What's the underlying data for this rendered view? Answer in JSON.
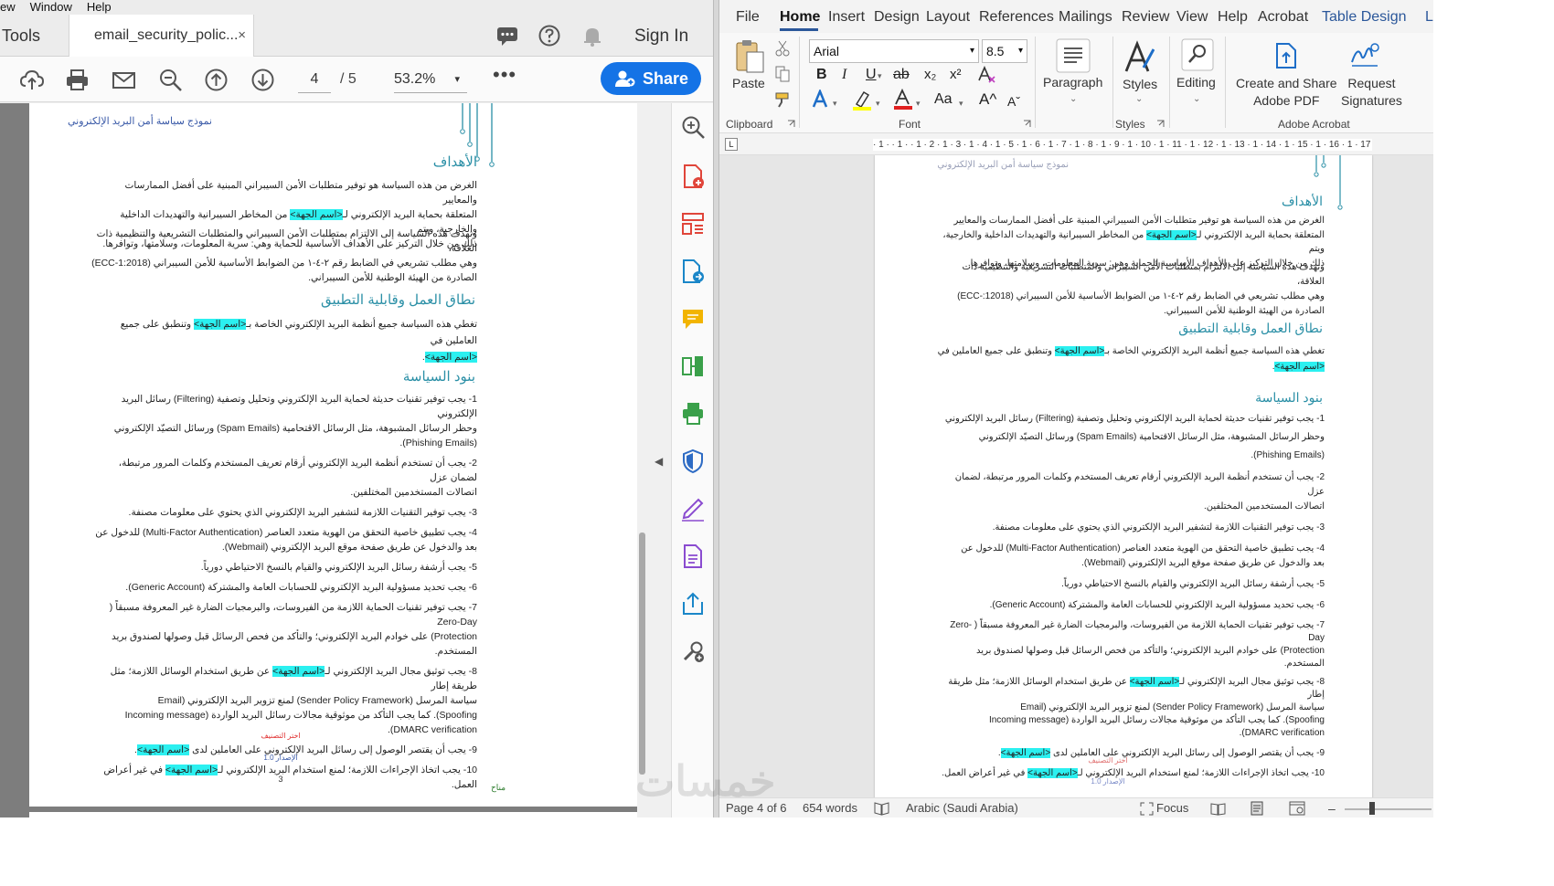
{
  "acrobat": {
    "menu": [
      "ew",
      "Window",
      "Help"
    ],
    "tools_tab": "Tools",
    "doc_tab": "email_security_polic...",
    "doc_tab_close": "×",
    "signin": "Sign In",
    "page_current": "4",
    "page_total": "/ 5",
    "zoom": "53.2%",
    "zoom_caret": "▾",
    "more": "•••",
    "share": "Share",
    "collapse_arrow": "◀",
    "page": {
      "header": "نموذج سياسة أمن البريد الإلكتروني",
      "h_objectives": "الأهداف",
      "p1_a": "الغرض من هذه السياسة هو توفير متطلبات الأمن السيبراني المبنية على أفضل الممارسات والمعايير",
      "p1_b_pre": "المتعلقة بحماية البريد الإلكتروني لـ",
      "p1_b_hl": "<اسم الجهة>",
      "p1_b_post": " من المخاطر السيبرانية والتهديدات الداخلية والخارجية، ويتم",
      "p1_c": "ذلك من خلال التركيز على الأهداف الأساسية للحماية وهي: سرية المعلومات، وسلامتها، وتوافرها.",
      "p2_a": "وتهدف هذه السياسة إلى الالتزام بمتطلبات الأمن السيبراني والمتطلبات التشريعية والتنظيمية ذات العلاقة،",
      "p2_b": "وهي مطلب تشريعي في الضابط رقم ٢-٤-١ من الضوابط الأساسية للأمن السيبراني (ECC-1:2018)",
      "p2_c": "الصادرة من الهيئة الوطنية للأمن السيبراني.",
      "h_scope": "نطاق العمل وقابلية التطبيق",
      "scope_a_pre": "تغطي هذه السياسة جميع أنظمة البريد الإلكتروني الخاصة بـ",
      "scope_a_hl": "<اسم الجهة>",
      "scope_a_post": " وتنطبق على جميع العاملين في",
      "scope_b_hl": "<اسم الجهة>",
      "scope_b_post": ".",
      "h_clauses": "بنود السياسة",
      "c1_a": "1- يجب توفير تقنيات حديثة لحماية البريد الإلكتروني وتحليل وتصفية (Filtering) رسائل البريد الإلكتروني",
      "c1_b": "وحظر الرسائل المشبوهة، مثل الرسائل الاقتحامية (Spam Emails) ورسائل التصيّد الإلكتروني",
      "c1_c": "(Phishing Emails).",
      "c2_a": "2- يجب أن تستخدم أنظمة البريد الإلكتروني أرقام تعريف المستخدم وكلمات المرور مرتبطة، لضمان عزل",
      "c2_b": "اتصالات المستخدمين المختلفين.",
      "c3": "3- يجب توفير التقنيات اللازمة لتشفير البريد الإلكتروني الذي يحتوي على معلومات مصنفة.",
      "c4_a": "4- يجب تطبيق خاصية التحقق من الهوية متعدد العناصر (Multi-Factor Authentication) للدخول عن",
      "c4_b": "بعد والدخول عن طريق صفحة موقع البريد الإلكتروني (Webmail).",
      "c5": "5- يجب أرشفة رسائل البريد الإلكتروني والقيام بالنسخ الاحتياطي دورياً.",
      "c6": "6- يجب تحديد مسؤولية البريد الإلكتروني للحسابات العامة والمشتركة (Generic Account).",
      "c7_a": "7- يجب توفير تقنيات الحماية اللازمة من الفيروسات، والبرمجيات الضارة غير المعروفة مسبقاً ( Zero-Day",
      "c7_b": "Protection) على خوادم البريد الإلكتروني؛ والتأكد من فحص الرسائل قبل وصولها لصندوق بريد",
      "c7_c": "المستخدم.",
      "c8_a_pre": "8- يجب توثيق مجال البريد الإلكتروني لـ",
      "c8_a_hl": "<اسم الجهة>",
      "c8_a_post": " عن طريق استخدام الوسائل اللازمة؛ مثل طريقة إطار",
      "c8_b": "سياسة المرسل (Sender Policy Framework) لمنع تزوير البريد الإلكتروني (Email",
      "c8_c": "Spoofing). كما يجب التأكد من موثوقية مجالات رسائل البريد الواردة (Incoming message",
      "c8_d": "DMARC verification).",
      "c9_pre": "9- يجب أن يقتصر الوصول إلى رسائل البريد الإلكتروني على العاملين لدى ",
      "c9_hl": "<اسم الجهة>",
      "c9_post": ".",
      "c10_pre": "10- يجب اتخاذ الإجراءات اللازمة؛ لمنع استخدام البريد الإلكتروني لـ",
      "c10_hl": "<اسم الجهة>",
      "c10_post": " في غير أعراض العمل.",
      "classification": "اختر التصنيف",
      "version": "الإصدار 1.0",
      "page_num": "3",
      "footer_mark": "مناح"
    }
  },
  "word": {
    "tabs": [
      "File",
      "Home",
      "Insert",
      "Design",
      "Layout",
      "References",
      "Mailings",
      "Review",
      "View",
      "Help",
      "Acrobat",
      "Table Design",
      "L"
    ],
    "ribbon": {
      "paste": "Paste",
      "clipboard": "Clipboard",
      "font_name": "Arial",
      "font_size": "8.5",
      "font_group": "Font",
      "paragraph": "Paragraph",
      "styles": "Styles",
      "styles_group": "Styles",
      "editing": "Editing",
      "create_share_1": "Create and Share",
      "create_share_2": "Adobe PDF",
      "request_1": "Request",
      "request_2": "Signatures",
      "adobe_group": "Adobe Acrobat",
      "bold": "B",
      "italic": "I",
      "underline": "U",
      "strike": "ab",
      "sub": "x₂",
      "sup": "x²",
      "case": "Aa",
      "grow": "A^",
      "shrink": "Aˇ"
    },
    "ruler": "· 1 · · 1 · · 1 · 2 · 1 · 3 · 1 · 4 · 1 · 5 · 1 · 6 · 1 · 7 · 1 · 8 · 1 · 9 · 1 · 10 · 1 · 11 · 1 · 12 · 1 · 13 · 1 · 14 · 1 · 15 · 1 · 16 · 1 · 17 · 1 · 18 · 1 · 19",
    "ruler_cap": "L",
    "status": {
      "page": "Page 4 of 6",
      "words": "654 words",
      "language": "Arabic (Saudi Arabia)",
      "focus": "Focus"
    },
    "page": {
      "header": "نموذج سياسة أمن البريد الإلكتروني",
      "p2_b": "وهي مطلب تشريعي في الضابط رقم ٢-٤-١ من الضوابط الأساسية للأمن السيبراني (ECC-:12018)"
    }
  },
  "watermark": "خمسات"
}
